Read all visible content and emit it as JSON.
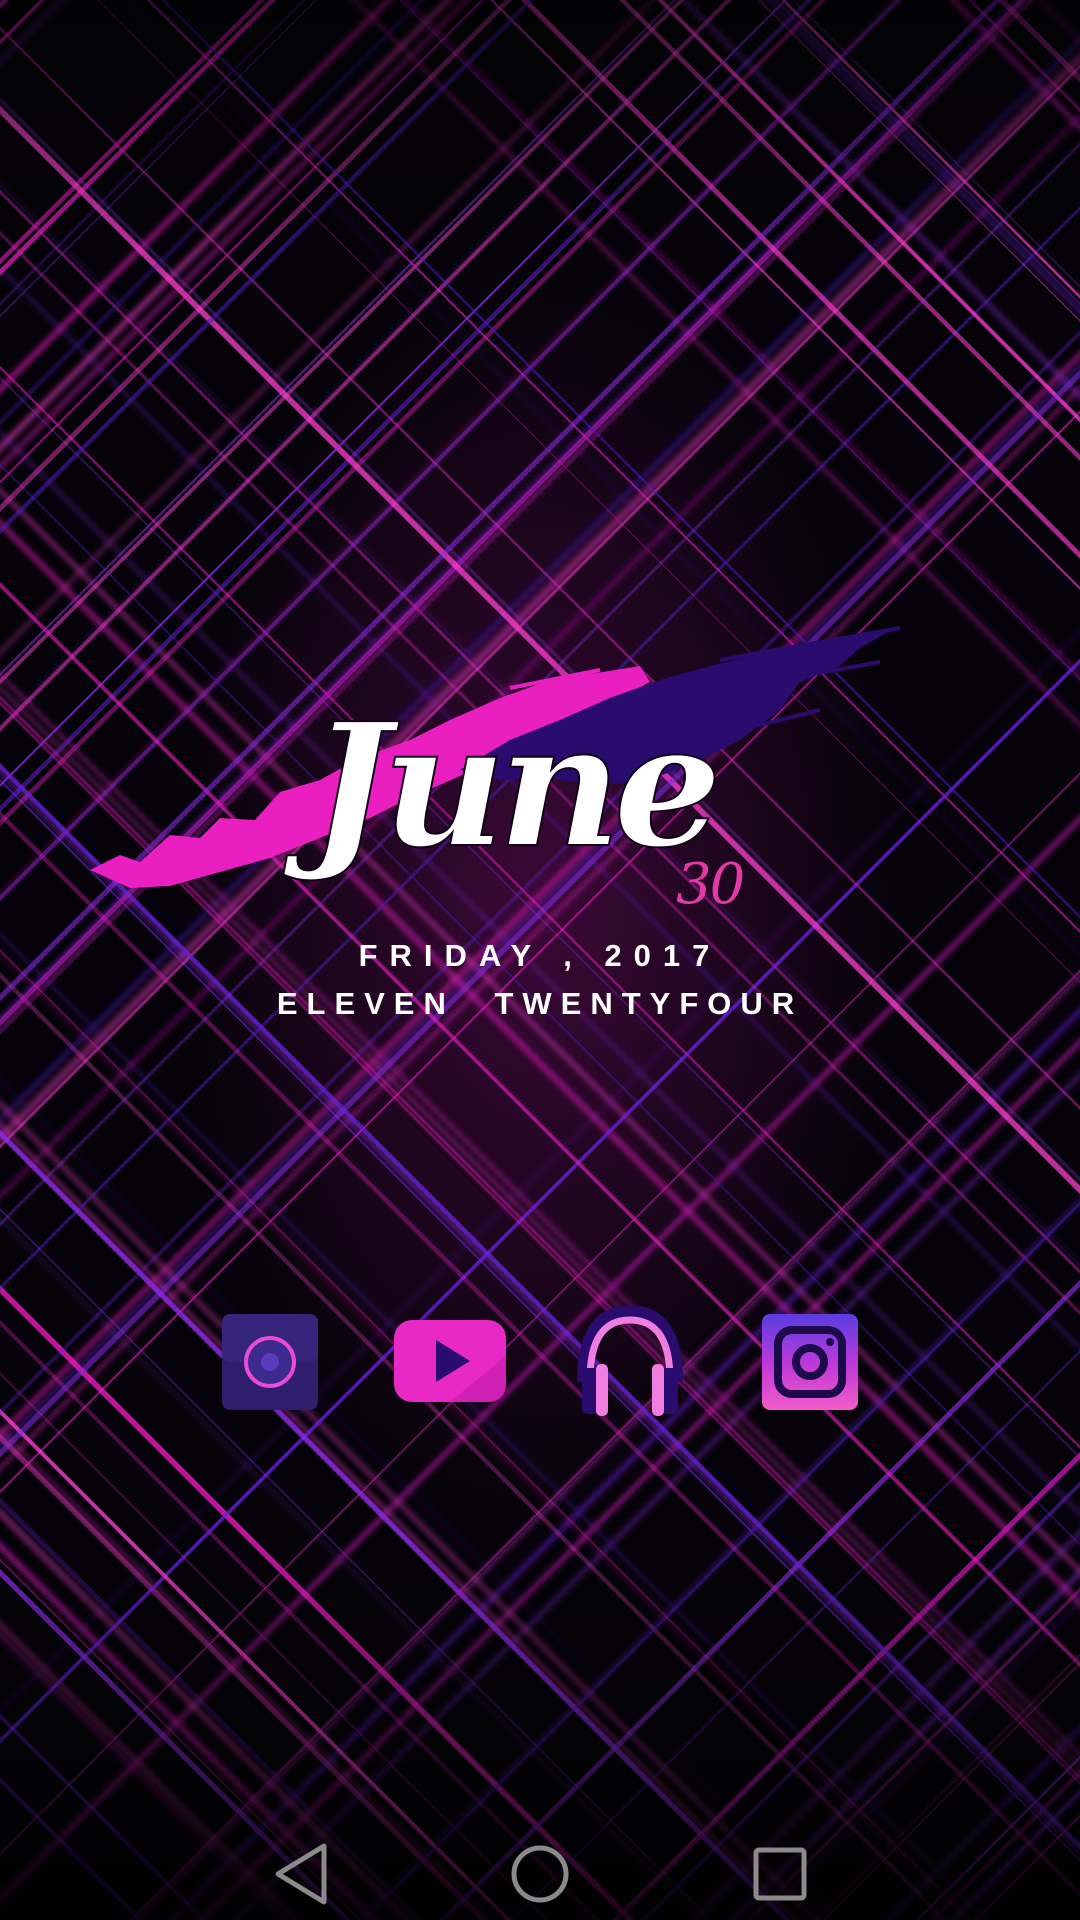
{
  "lock_screen": {
    "month": "June",
    "day": "30",
    "weekday_year": "FRIDAY , 2017",
    "time_words": "ELEVEN TWENTYFOUR"
  },
  "dock": {
    "apps": [
      {
        "icon": "camera-icon"
      },
      {
        "icon": "youtube-icon"
      },
      {
        "icon": "headphones-music-icon"
      },
      {
        "icon": "instagram-icon"
      }
    ]
  },
  "nav_bar": {
    "buttons": [
      "back-icon",
      "home-icon",
      "recents-icon"
    ]
  },
  "colors": {
    "accent_pink": "#e91fc0",
    "accent_violet": "#2a0b6e",
    "background": "#050309"
  }
}
